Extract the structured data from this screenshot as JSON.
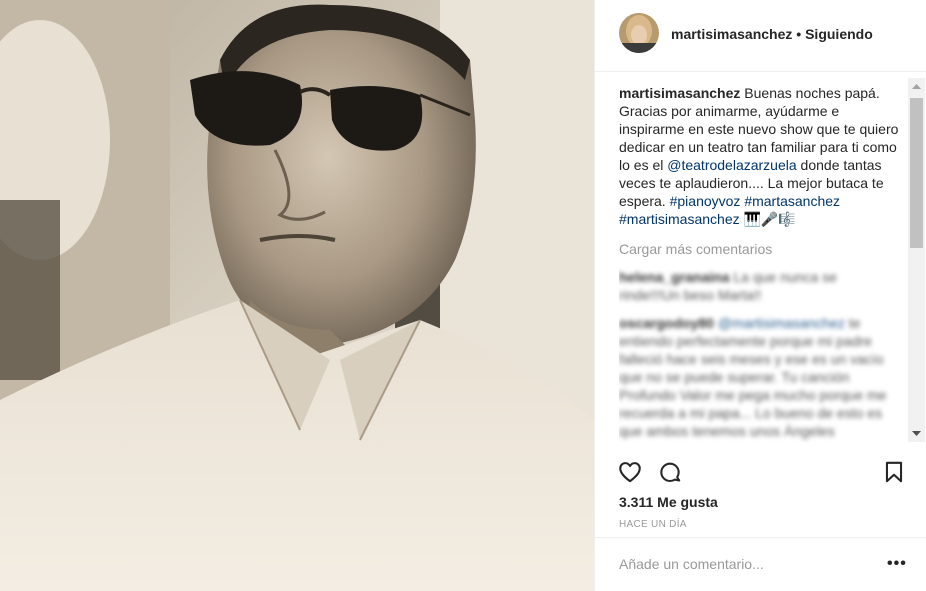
{
  "post": {
    "photo_alt": "black and white vintage portrait",
    "username": "martisimasanchez",
    "separator": "•",
    "follow_status": "Siguiendo"
  },
  "caption": {
    "username": "martisimasanchez",
    "text_1": " Buenas noches papá. Gracias por animarme, ayúdarme e inspirarme en este nuevo show que te quiero dedicar en un teatro tan familiar para ti como lo es el ",
    "mention": "@teatrodelazarzuela",
    "text_2": " donde tantas veces te aplaudieron.... La mejor butaca te espera. ",
    "hashtags": [
      "#pianoyvoz",
      "#martasanchez",
      "#martisimasanchez"
    ],
    "emoji": "🎹🎤🎼"
  },
  "comments": {
    "load_more": "Cargar más comentarios",
    "items": [
      {
        "username": "helena_granaina",
        "text": " La que nunca se rinde!!!Un beso Marta!!"
      },
      {
        "username": "oscargodoy80",
        "mention": "@martisimasanchez",
        "text": " te entiendo perfectamente porque mi padre falleció hace seis meses y ese es un vacío que no se puede superar. Tu canción Profundo Valor me pega mucho porque me recuerda a mi papa... Lo bueno de esto es que ambos tenemos unos Ángeles"
      }
    ]
  },
  "stats": {
    "likes": "3.311 Me gusta",
    "time": "HACE UN DÍA"
  },
  "add_comment": {
    "placeholder": "Añade un comentario...",
    "more": "•••"
  },
  "icons": {
    "like": "heart-icon",
    "comment": "comment-icon",
    "save": "bookmark-icon",
    "more": "more-options-icon"
  }
}
